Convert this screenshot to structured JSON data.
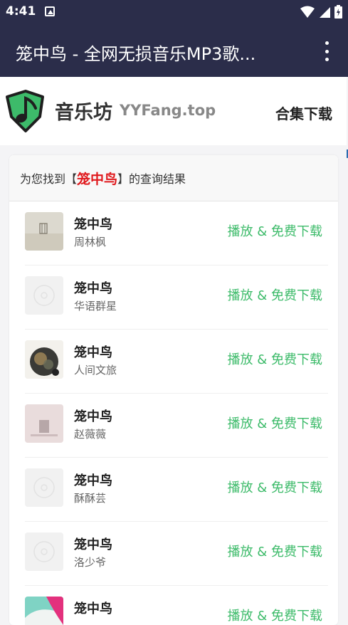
{
  "status_bar": {
    "time": "4:41"
  },
  "app_bar": {
    "title": "笼中鸟 - 全网无损音乐MP3歌..."
  },
  "site": {
    "name": "音乐坊",
    "domain": "YYFang.top",
    "collection_link": "合集下载"
  },
  "results": {
    "prefix": "为您找到【",
    "keyword": "笼中鸟",
    "suffix": "】的查询结果",
    "items": [
      {
        "title": "笼中鸟",
        "artist": "周林枫",
        "action": "播放 & 免费下载"
      },
      {
        "title": "笼中鸟",
        "artist": "华语群星",
        "action": "播放 & 免费下载"
      },
      {
        "title": "笼中鸟",
        "artist": "人间文旅",
        "action": "播放 & 免费下载"
      },
      {
        "title": "笼中鸟",
        "artist": "赵薇薇",
        "action": "播放 & 免费下载"
      },
      {
        "title": "笼中鸟",
        "artist": "酥酥芸",
        "action": "播放 & 免费下载"
      },
      {
        "title": "笼中鸟",
        "artist": "洛少爷",
        "action": "播放 & 免费下载"
      },
      {
        "title": "笼中鸟",
        "artist": "",
        "action": "播放 & 免费下载"
      }
    ]
  },
  "colors": {
    "appbar": "#2b2d4a",
    "accent_green": "#3dbb6a",
    "keyword_red": "#e0181c"
  },
  "icons": [
    "notification-icon",
    "wifi-icon",
    "signal-icon",
    "battery-icon",
    "overflow-menu-icon",
    "music-note-logo-icon"
  ]
}
